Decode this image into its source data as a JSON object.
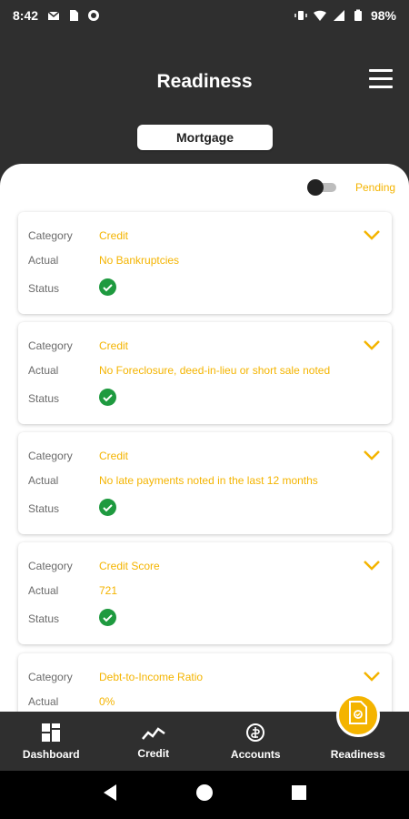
{
  "status_bar": {
    "time": "8:42",
    "battery": "98%"
  },
  "header": {
    "title": "Readiness",
    "segment_label": "Mortgage"
  },
  "filter": {
    "toggle_label": "Pending"
  },
  "cards": [
    {
      "category_label": "Category",
      "category": "Credit",
      "actual_label": "Actual",
      "actual": "No Bankruptcies",
      "status_label": "Status",
      "status": "check-icon"
    },
    {
      "category_label": "Category",
      "category": "Credit",
      "actual_label": "Actual",
      "actual": "No Foreclosure, deed-in-lieu or short sale noted",
      "status_label": "Status",
      "status": "check-icon"
    },
    {
      "category_label": "Category",
      "category": "Credit",
      "actual_label": "Actual",
      "actual": "No late payments noted in the last 12 months",
      "status_label": "Status",
      "status": "check-icon"
    },
    {
      "category_label": "Category",
      "category": "Credit Score",
      "actual_label": "Actual",
      "actual": "721",
      "status_label": "Status",
      "status": "check-icon"
    },
    {
      "category_label": "Category",
      "category": "Debt-to-Income Ratio",
      "actual_label": "Actual",
      "actual": "0%"
    }
  ],
  "bottom_nav": {
    "items": [
      {
        "label": "Dashboard",
        "icon": "dashboard-icon"
      },
      {
        "label": "Credit",
        "icon": "trend-icon"
      },
      {
        "label": "Accounts",
        "icon": "accounts-icon"
      },
      {
        "label": "Readiness",
        "icon": "readiness-icon"
      }
    ]
  },
  "colors": {
    "accent": "#f4b400",
    "dark": "#2f2f2f",
    "success": "#1e9a3f"
  }
}
